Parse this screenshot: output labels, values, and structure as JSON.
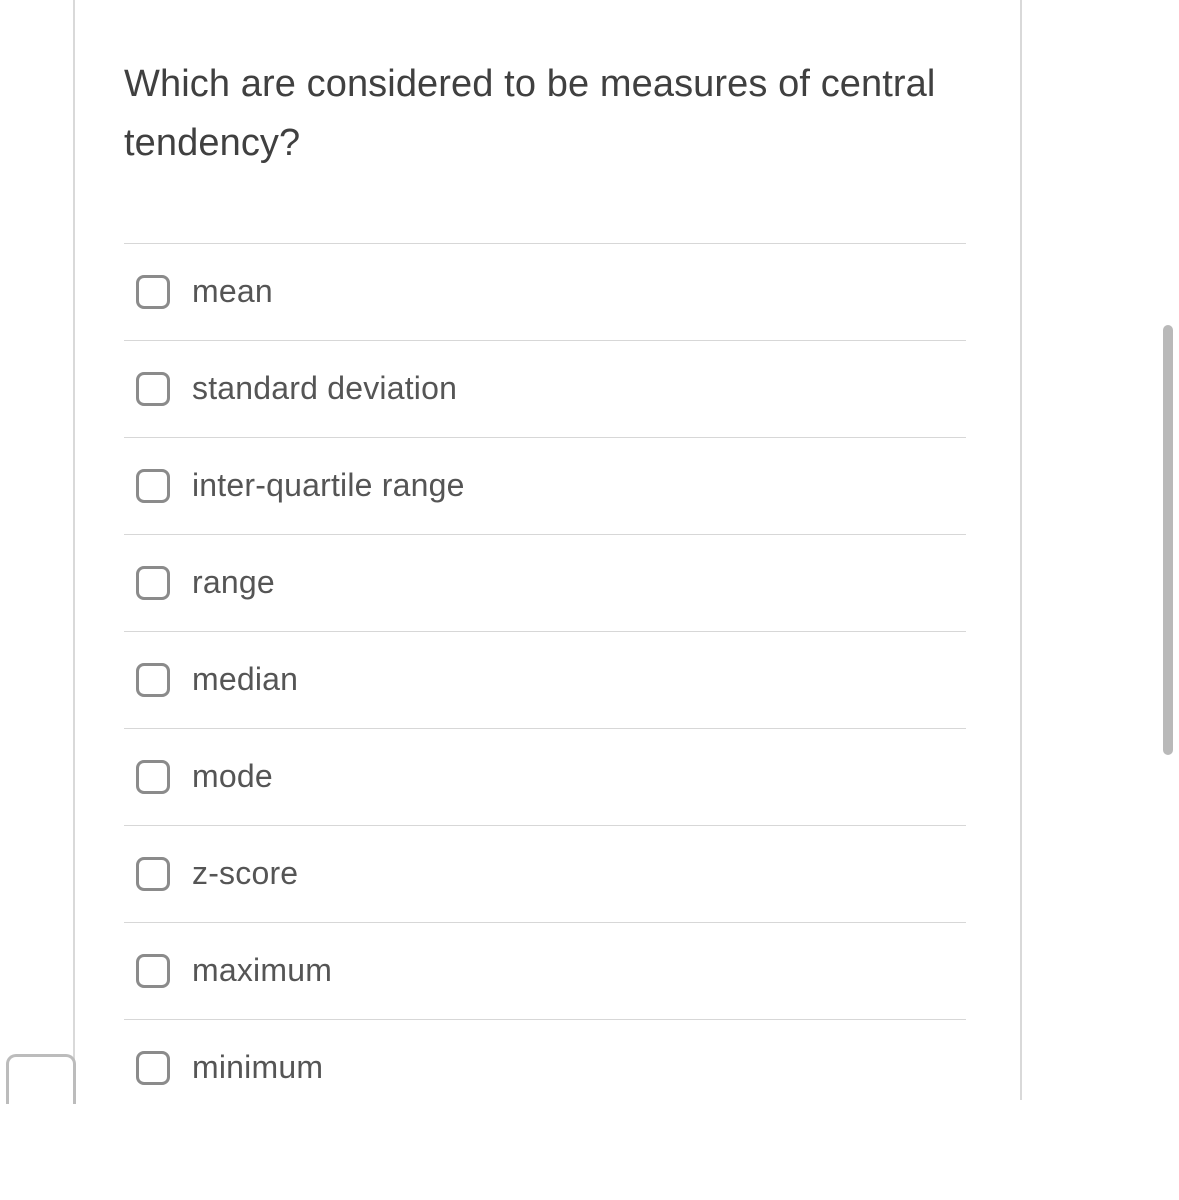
{
  "question": "Which are considered to be measures of central tendency?",
  "options": [
    {
      "label": "mean"
    },
    {
      "label": "standard deviation"
    },
    {
      "label": "inter-quartile range"
    },
    {
      "label": "range"
    },
    {
      "label": "median"
    },
    {
      "label": "mode"
    },
    {
      "label": "z-score"
    },
    {
      "label": "maximum"
    },
    {
      "label": "minimum"
    }
  ]
}
